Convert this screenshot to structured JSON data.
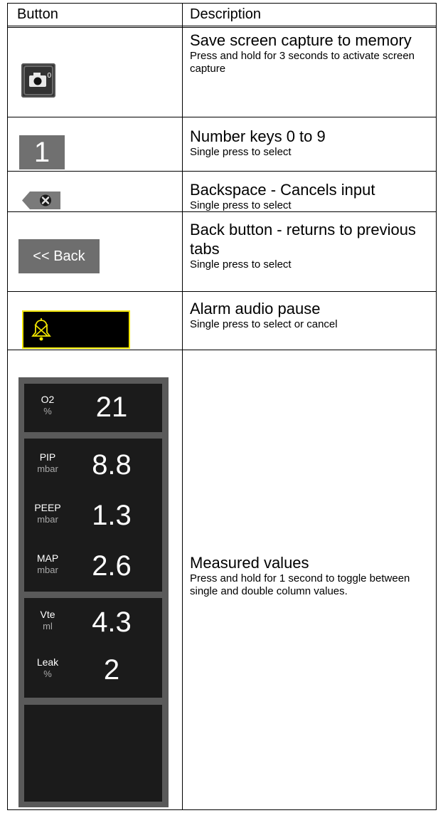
{
  "header": {
    "col_button": "Button",
    "col_description": "Description"
  },
  "rows": [
    {
      "title": "Save screen capture to memory",
      "sub": "Press and hold for 3 seconds to activate screen capture",
      "icon": "camera-icon",
      "icon_text": "0"
    },
    {
      "title": "Number keys 0 to 9",
      "sub": "Single press to select",
      "button_text": "1"
    },
    {
      "title": "Backspace - Cancels input",
      "sub": "Single press to select",
      "icon": "backspace-icon"
    },
    {
      "title": "Back button - returns to previous tabs",
      "sub": "Single press to select",
      "button_text": "<< Back"
    },
    {
      "title": "Alarm audio pause",
      "sub": "Single press to select or cancel",
      "icon": "alarm-bell-muted-icon"
    },
    {
      "title": "Measured values",
      "sub": "Press and hold for 1 second to toggle between single and double column values."
    }
  ],
  "measured": [
    {
      "label": "O2",
      "unit": "%",
      "value": "21"
    },
    {
      "label": "PIP",
      "unit": "mbar",
      "value": "8.8"
    },
    {
      "label": "PEEP",
      "unit": "mbar",
      "value": "1.3"
    },
    {
      "label": "MAP",
      "unit": "mbar",
      "value": "2.6"
    },
    {
      "label": "Vte",
      "unit": "ml",
      "value": "4.3"
    },
    {
      "label": "Leak",
      "unit": "%",
      "value": "2"
    }
  ],
  "colors": {
    "alarm_border": "#f2e600",
    "panel_bg": "#5a5a5a",
    "box_bg": "#1b1b1b",
    "key_bg": "#707070"
  }
}
